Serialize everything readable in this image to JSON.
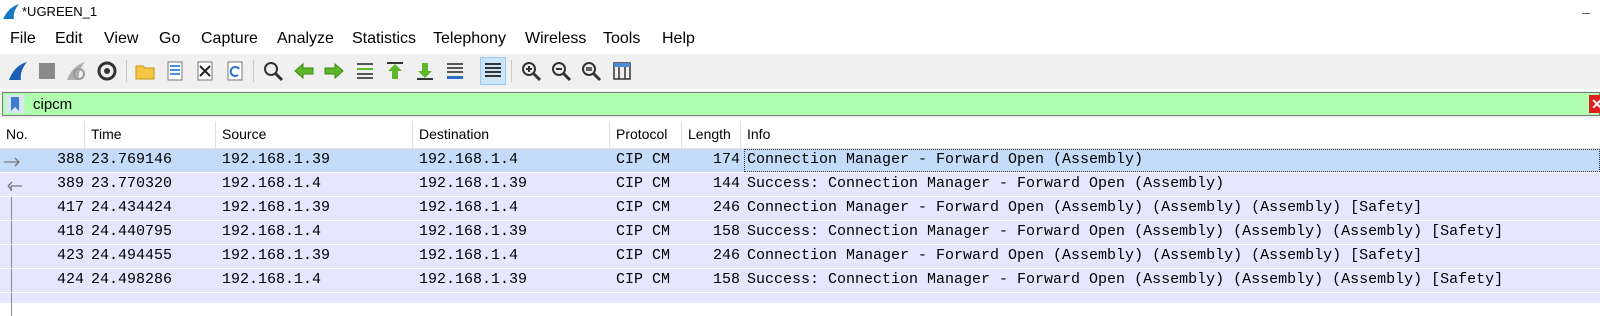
{
  "window": {
    "title": "*UGREEN_1",
    "minimize_glyph": "–"
  },
  "menu": [
    {
      "label": "File"
    },
    {
      "label": "Edit"
    },
    {
      "label": "View"
    },
    {
      "label": "Go"
    },
    {
      "label": "Capture"
    },
    {
      "label": "Analyze"
    },
    {
      "label": "Statistics"
    },
    {
      "label": "Telephony"
    },
    {
      "label": "Wireless"
    },
    {
      "label": "Tools"
    },
    {
      "label": "Help"
    }
  ],
  "toolbar": {
    "icons": [
      "start-capture-icon",
      "stop-capture-icon",
      "restart-capture-icon",
      "capture-options-icon",
      "open-file-icon",
      "save-file-icon",
      "close-file-icon",
      "reload-file-icon",
      "find-packet-icon",
      "go-back-icon",
      "go-forward-icon",
      "go-to-packet-icon",
      "first-packet-icon",
      "last-packet-icon",
      "autoscroll-icon",
      "colorize-icon",
      "zoom-in-icon",
      "zoom-out-icon",
      "normal-size-icon",
      "resize-columns-icon"
    ]
  },
  "filter": {
    "value": "cipcm",
    "clear_glyph": "✕"
  },
  "columns": [
    "No.",
    "Time",
    "Source",
    "Destination",
    "Protocol",
    "Length",
    "Info"
  ],
  "packets": [
    {
      "no": "388",
      "time": "23.769146",
      "src": "192.168.1.39",
      "dst": "192.168.1.4",
      "proto": "CIP CM",
      "len": "174",
      "info": "Connection Manager - Forward Open (Assembly)",
      "selected": true,
      "related": "request"
    },
    {
      "no": "389",
      "time": "23.770320",
      "src": "192.168.1.4",
      "dst": "192.168.1.39",
      "proto": "CIP CM",
      "len": "144",
      "info": "Success: Connection Manager - Forward Open (Assembly)",
      "selected": false,
      "related": "response"
    },
    {
      "no": "417",
      "time": "24.434424",
      "src": "192.168.1.39",
      "dst": "192.168.1.4",
      "proto": "CIP CM",
      "len": "246",
      "info": "Connection Manager - Forward Open (Assembly) (Assembly) (Assembly) [Safety]",
      "selected": false,
      "related": "line"
    },
    {
      "no": "418",
      "time": "24.440795",
      "src": "192.168.1.4",
      "dst": "192.168.1.39",
      "proto": "CIP CM",
      "len": "158",
      "info": "Success: Connection Manager - Forward Open (Assembly) (Assembly) (Assembly) [Safety]",
      "selected": false,
      "related": "line"
    },
    {
      "no": "423",
      "time": "24.494455",
      "src": "192.168.1.39",
      "dst": "192.168.1.4",
      "proto": "CIP CM",
      "len": "246",
      "info": "Connection Manager - Forward Open (Assembly) (Assembly) (Assembly) [Safety]",
      "selected": false,
      "related": "line"
    },
    {
      "no": "424",
      "time": "24.498286",
      "src": "192.168.1.4",
      "dst": "192.168.1.39",
      "proto": "CIP CM",
      "len": "158",
      "info": "Success: Connection Manager - Forward Open (Assembly) (Assembly) (Assembly) [Safety]",
      "selected": false,
      "related": "line"
    }
  ],
  "colors": {
    "row_bg": "#e7e6ff",
    "selected_bg": "#c4dcf9",
    "filter_valid_bg": "#afffaf",
    "toolbar_bg": "#f0f0f0"
  }
}
